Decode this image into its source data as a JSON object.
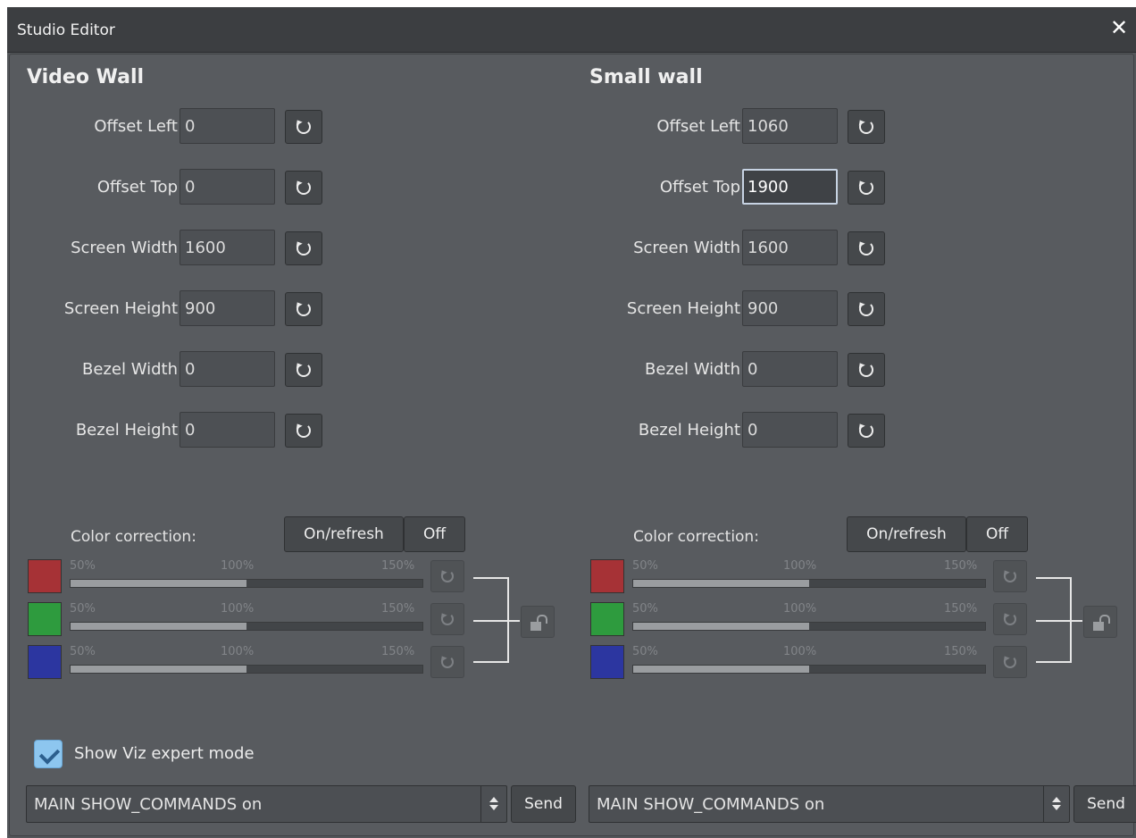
{
  "window": {
    "title": "Studio Editor",
    "close_icon": "close-icon"
  },
  "expert_mode": {
    "label": "Show Viz expert mode",
    "checked": true
  },
  "walls": [
    {
      "title": "Video Wall",
      "fields": [
        {
          "label": "Offset Left",
          "value": "0"
        },
        {
          "label": "Offset Top",
          "value": "0"
        },
        {
          "label": "Screen Width",
          "value": "1600"
        },
        {
          "label": "Screen Height",
          "value": "900"
        },
        {
          "label": "Bezel Width",
          "value": "0"
        },
        {
          "label": "Bezel Height",
          "value": "0"
        }
      ],
      "color_correction": {
        "label": "Color correction:",
        "on_label": "On/refresh",
        "off_label": "Off",
        "channels": [
          {
            "color": "#a63236",
            "min": "50%",
            "mid": "100%",
            "max": "150%",
            "value_fraction": 0.5
          },
          {
            "color": "#2e9b3e",
            "min": "50%",
            "mid": "100%",
            "max": "150%",
            "value_fraction": 0.5
          },
          {
            "color": "#2c36a0",
            "min": "50%",
            "mid": "100%",
            "max": "150%",
            "value_fraction": 0.5
          }
        ]
      },
      "command": {
        "value": "MAIN SHOW_COMMANDS on",
        "send_label": "Send"
      }
    },
    {
      "title": "Small wall",
      "fields": [
        {
          "label": "Offset Left",
          "value": "1060"
        },
        {
          "label": "Offset Top",
          "value": "1900"
        },
        {
          "label": "Screen Width",
          "value": "1600"
        },
        {
          "label": "Screen Height",
          "value": "900"
        },
        {
          "label": "Bezel Width",
          "value": "0"
        },
        {
          "label": "Bezel Height",
          "value": "0"
        }
      ],
      "color_correction": {
        "label": "Color correction:",
        "on_label": "On/refresh",
        "off_label": "Off",
        "channels": [
          {
            "color": "#a63236",
            "min": "50%",
            "mid": "100%",
            "max": "150%",
            "value_fraction": 0.5
          },
          {
            "color": "#2e9b3e",
            "min": "50%",
            "mid": "100%",
            "max": "150%",
            "value_fraction": 0.5
          },
          {
            "color": "#2c36a0",
            "min": "50%",
            "mid": "100%",
            "max": "150%",
            "value_fraction": 0.5
          }
        ]
      },
      "command": {
        "value": "MAIN SHOW_COMMANDS on",
        "send_label": "Send"
      }
    }
  ]
}
